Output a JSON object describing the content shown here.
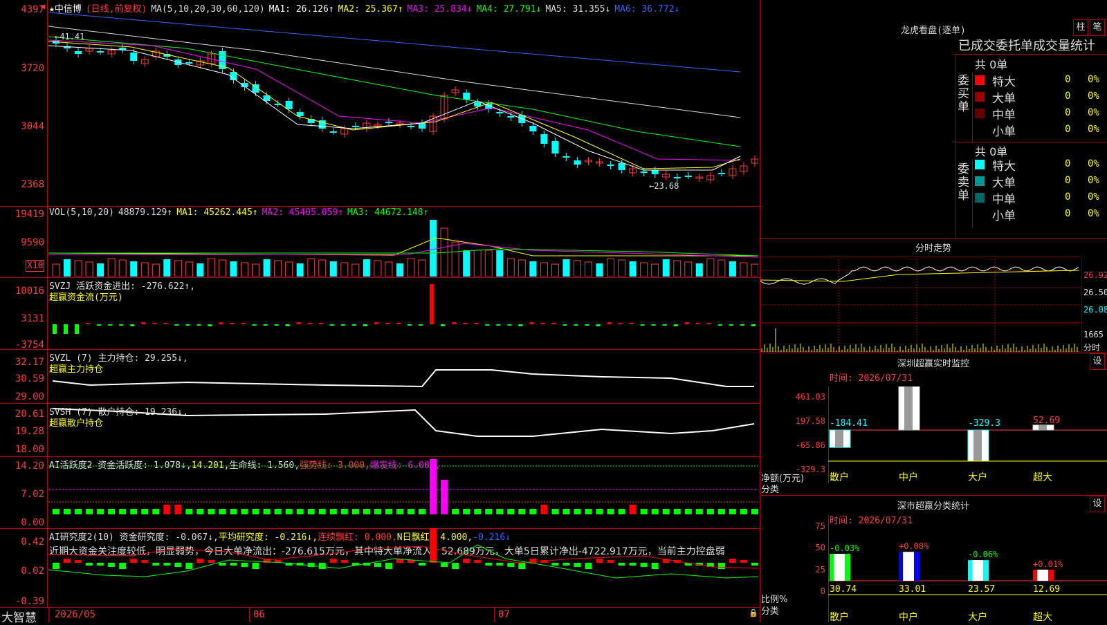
{
  "main": {
    "stock": "★中信博",
    "period": "(日线,前复权)",
    "ma_label": "MA(5,10,20,30,60,120)",
    "ma": [
      {
        "label": "MA1: 26.126↑",
        "color": "#ffffff"
      },
      {
        "label": "MA2: 25.367↑",
        "color": "#ffff00"
      },
      {
        "label": "MA3: 25.834↓",
        "color": "#ff00ff"
      },
      {
        "label": "MA4: 27.791↓",
        "color": "#00ff00"
      },
      {
        "label": "MA5: 31.355↓",
        "color": "#dddddd"
      },
      {
        "label": "MA6: 36.772↓",
        "color": "#3366ff"
      }
    ],
    "yticks": [
      "4397",
      "3720",
      "3044",
      "2368"
    ],
    "high_label": "41.41",
    "low_label": "23.68"
  },
  "vol": {
    "header": "VOL(5,10,20)",
    "value": "48879.129↑",
    "ma1": "MA1: 45262.445↑",
    "ma2": "MA2: 45405.059↑",
    "ma3": "MA3: 44672.148↑",
    "yticks": [
      "19419",
      "9590"
    ],
    "unit": "X10"
  },
  "svzj": {
    "header": "SVZJ  活跃资金进出: -276.622↑,",
    "sub": "超赢资金流(万元)",
    "yticks": [
      "10016",
      "3131",
      "-3754"
    ]
  },
  "svzl": {
    "header": "SVZL (7) 主力持仓: 29.255↓,",
    "sub": "超赢主力持仓",
    "yticks": [
      "32.17",
      "30.59",
      "29.00"
    ]
  },
  "svsh": {
    "header": "SVSH (7) 散户持仓: 19.236↓,",
    "sub": "超赢散户持仓",
    "yticks": [
      "20.61",
      "19.28",
      "18.00"
    ]
  },
  "ai1": {
    "header_a": "AI活跃度2 资金活跃度: 1.078↓,",
    "header_b": "14.201,",
    "header_c": "生命线: 1.560,",
    "header_d": "强势线: 3.000,",
    "header_e": "爆发线: 6.000,",
    "yticks": [
      "14.20",
      "7.02",
      "0.00"
    ]
  },
  "ai2": {
    "header_a": "AI研究度2(10) 资金研究度: -0.067↓,",
    "header_b": "平均研究度: -0.216↓,",
    "header_c": "连续飘红: 0.000,",
    "header_d": "N日飘红: 4.000,",
    "header_e": "-0.216↓",
    "commentary": "近期大资金关注度较低，明显弱势，今日大单净流出：-276.615万元，其中特大单净流入：52.689万元，大单5日累计净出-4722.917万元，当前主力控盘弱",
    "yticks": [
      "0.42",
      "0.02",
      "-0.39"
    ]
  },
  "footer": {
    "brand": "大智慧",
    "dates": [
      "2026/05",
      "06",
      "07"
    ]
  },
  "longhu": {
    "title": "龙虎看盘(逐单)",
    "btn1": "柱",
    "btn2": "笔",
    "tabs": "已成交委托单成交量统计",
    "buy_total": "共 0单",
    "buy_label": "委买单",
    "sell_total": "共 0单",
    "sell_label": "委卖单",
    "buy_rows": [
      {
        "label": "特大",
        "count": "0",
        "pct": "0%",
        "color": "#ff0000"
      },
      {
        "label": "大单",
        "count": "0",
        "pct": "0%",
        "color": "#990000"
      },
      {
        "label": "中单",
        "count": "0",
        "pct": "0%",
        "color": "#660000"
      },
      {
        "label": "小单",
        "count": "0",
        "pct": "0%",
        "color": "#000000"
      }
    ],
    "sell_rows": [
      {
        "label": "特大",
        "count": "0",
        "pct": "0%",
        "color": "#00ffff"
      },
      {
        "label": "大单",
        "count": "0",
        "pct": "0%",
        "color": "#009999"
      },
      {
        "label": "中单",
        "count": "0",
        "pct": "0%",
        "color": "#006666"
      },
      {
        "label": "小单",
        "count": "0",
        "pct": "0%",
        "color": "#000000"
      }
    ]
  },
  "intraday": {
    "title": "分时走势",
    "yticks": [
      "26.92",
      "26.50",
      "26.08",
      "1665"
    ],
    "unit": "分时"
  },
  "sz_monitor": {
    "title": "深圳超赢实时监控",
    "btn": "设",
    "time": "时间: 2026/07/31",
    "yticks": [
      "461.03",
      "197.58",
      "-65.86",
      "-329.3"
    ],
    "ylabel1": "净额(万元)",
    "ylabel2": "分类",
    "cats": [
      "散户",
      "中户",
      "大户",
      "超大"
    ],
    "values": [
      "-184.41",
      "461.03",
      "-329.3",
      "52.69"
    ]
  },
  "sz_class": {
    "title": "深市超赢分类统计",
    "btn": "设",
    "time": "时间: 2026/07/31",
    "yticks": [
      "75",
      "50",
      "25",
      "0"
    ],
    "ylabel1": "比例%",
    "ylabel2": "分类",
    "cats": [
      "散户",
      "中户",
      "大户",
      "超大"
    ],
    "changes": [
      "-0.03%",
      "+0.08%",
      "-0.06%",
      "+0.01%"
    ],
    "values": [
      "30.74",
      "33.01",
      "23.57",
      "12.69"
    ]
  }
}
